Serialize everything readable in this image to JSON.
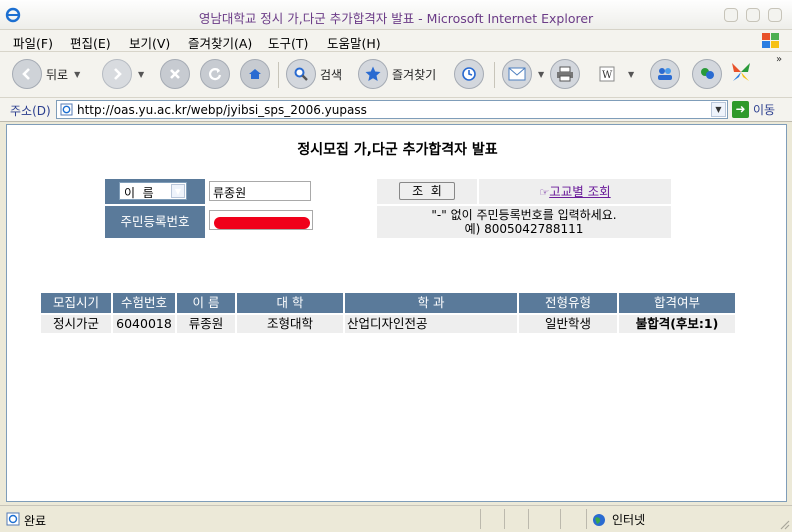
{
  "window": {
    "title": "영남대학교 정시 가,다군 추가합격자 발표 - Microsoft Internet Explorer"
  },
  "menu": [
    "파일(F)",
    "편집(E)",
    "보기(V)",
    "즐겨찾기(A)",
    "도구(T)",
    "도움말(H)"
  ],
  "toolbar": {
    "back_label": "뒤로",
    "search_label": "검색",
    "favorites_label": "즐겨찾기"
  },
  "address": {
    "label": "주소(D)",
    "url": "http://oas.yu.ac.kr/webp/jyibsi_sps_2006.yupass",
    "go_label": "이동"
  },
  "page": {
    "title": "정시모집 가,다군 추가합격자 발표",
    "form": {
      "name_select": "이  름",
      "name_value": "류종원",
      "search_button": "조  회",
      "school_link": "고교별 조회",
      "rrn_label": "주민등록번호",
      "hint_line1": "\"-\" 없이 주민등록번호를 입력하세요.",
      "hint_line2": "예) 8005042788111"
    },
    "results": {
      "headers": [
        "모집시기",
        "수험번호",
        "이 름",
        "대 학",
        "학 과",
        "전형유형",
        "합격여부"
      ],
      "row": [
        "정시가군",
        "6040018",
        "류종원",
        "조형대학",
        "산업디자인전공",
        "일반학생",
        "불합격(후보:1)"
      ]
    }
  },
  "status": {
    "text": "완료",
    "zone": "인터넷"
  },
  "colors": {
    "header_bg": "#5a7a9a",
    "cell_bg": "#eeeeee",
    "link": "#6a1b9a",
    "title_text": "#6b3b87"
  }
}
